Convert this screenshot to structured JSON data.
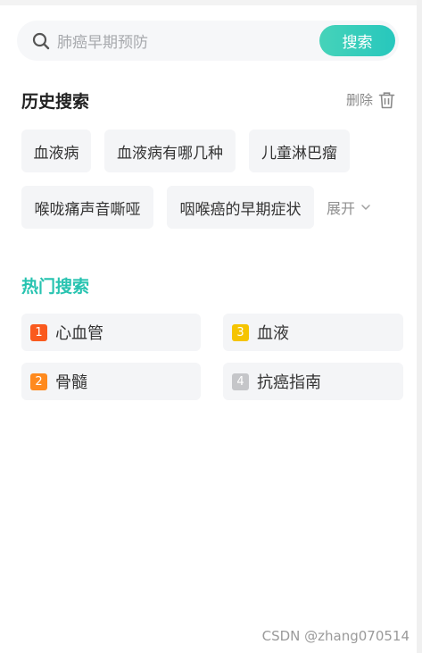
{
  "search": {
    "placeholder": "肺癌早期预防",
    "button_label": "搜索"
  },
  "history": {
    "title": "历史搜索",
    "delete_label": "删除",
    "expand_label": "展开",
    "tags": [
      "血液病",
      "血液病有哪几种",
      "儿童淋巴瘤",
      "喉咙痛声音嘶哑",
      "咽喉癌的早期症状"
    ]
  },
  "hot": {
    "title": "热门搜索",
    "items": [
      {
        "rank": "1",
        "label": "心血管",
        "badge_color": "#fa5a1e"
      },
      {
        "rank": "3",
        "label": "血液",
        "badge_color": "#f5c400"
      },
      {
        "rank": "2",
        "label": "骨髓",
        "badge_color": "#ff8a1e"
      },
      {
        "rank": "4",
        "label": "抗癌指南",
        "badge_color": "#c5c6c9"
      }
    ]
  },
  "watermark": "CSDN @zhang070514",
  "colors": {
    "accent": "#2bc8b8",
    "tag_bg": "#f4f5f7"
  },
  "icons": [
    "search-icon",
    "trash-icon",
    "chevron-down-icon"
  ]
}
